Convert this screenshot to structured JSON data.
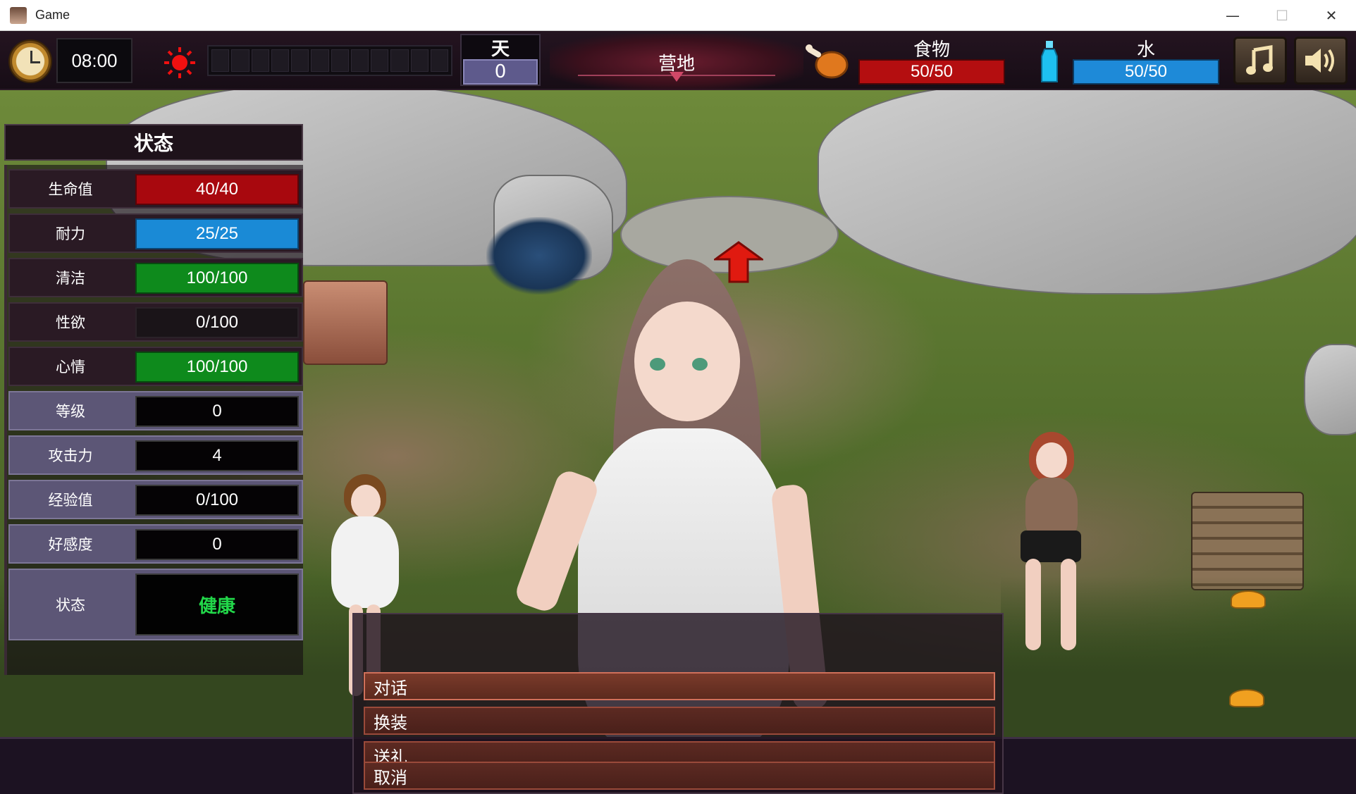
{
  "window": {
    "title": "Game",
    "minimize": "—",
    "maximize": "☐",
    "close": "✕"
  },
  "hud": {
    "time": "08:00",
    "day_label": "天",
    "day_value": "0",
    "location": "营地",
    "food_label": "食物",
    "food_value": "50/50",
    "water_label": "水",
    "water_value": "50/50"
  },
  "status_panel": {
    "title": "状态",
    "rows": [
      {
        "label": "生命值",
        "value": "40/40"
      },
      {
        "label": "耐力",
        "value": "25/25"
      },
      {
        "label": "清洁",
        "value": "100/100"
      },
      {
        "label": "性欲",
        "value": "0/100"
      },
      {
        "label": "心情",
        "value": "100/100"
      },
      {
        "label": "等级",
        "value": "0"
      },
      {
        "label": "攻击力",
        "value": "4"
      },
      {
        "label": "经验值",
        "value": "0/100"
      },
      {
        "label": "好感度",
        "value": "0"
      },
      {
        "label": "状态",
        "value": "健康"
      }
    ]
  },
  "menu": {
    "items": [
      {
        "label": "对话"
      },
      {
        "label": "换装"
      },
      {
        "label": "送礼"
      },
      {
        "label": "取消"
      }
    ]
  },
  "colors": {
    "health": "#a8080e",
    "stamina": "#1a8ad6",
    "clean": "#0e8a1c",
    "food": "#b40e10",
    "water": "#1e8ad8",
    "status_text": "#22d84a"
  },
  "icons": {
    "clock": "clock-icon",
    "sun": "sun-icon",
    "food": "meat-icon",
    "water": "bottle-icon",
    "music": "music-note-icon",
    "sound": "speaker-icon"
  }
}
